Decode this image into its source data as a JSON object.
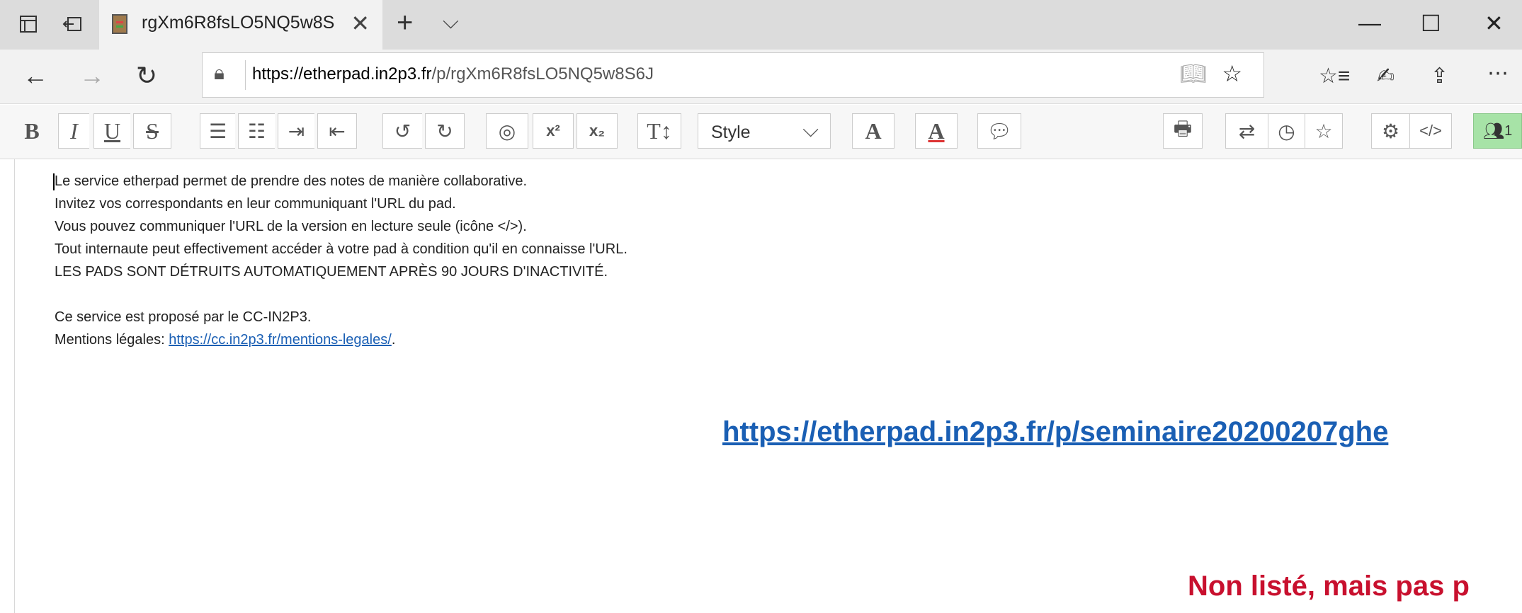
{
  "browser": {
    "tab_title": "rgXm6R8fsLO5NQ5w8S",
    "url_host": "https://etherpad.in2p3.fr",
    "url_path": "/p/rgXm6R8fsLO5NQ5w8S6J"
  },
  "toolbar": {
    "style_select_value": "Style",
    "users_count": "1"
  },
  "editor": {
    "lines": [
      "Le service etherpad permet de prendre des notes de manière collaborative.",
      "Invitez vos correspondants en leur communiquant l'URL du pad.",
      "Vous pouvez communiquer l'URL de la version en lecture seule (icône </>).",
      "Tout internaute peut effectivement accéder à votre pad à condition qu'il en connaisse l'URL.",
      "LES PADS SONT DÉTRUITS AUTOMATIQUEMENT APRÈS 90 JOURS D'INACTIVITÉ.",
      "Ce service est proposé par le CC-IN2P3."
    ],
    "legal_prefix": "Mentions légales: ",
    "legal_link": "https://cc.in2p3.fr/mentions-legales/",
    "legal_suffix": "."
  },
  "overlay": {
    "big_link": "https://etherpad.in2p3.fr/p/seminaire20200207ghe",
    "red_text": "Non listé, mais pas p"
  },
  "colors": {
    "link": "#1a5fb4",
    "red_text": "#c8102e",
    "users_button": "#a7e3a7"
  }
}
